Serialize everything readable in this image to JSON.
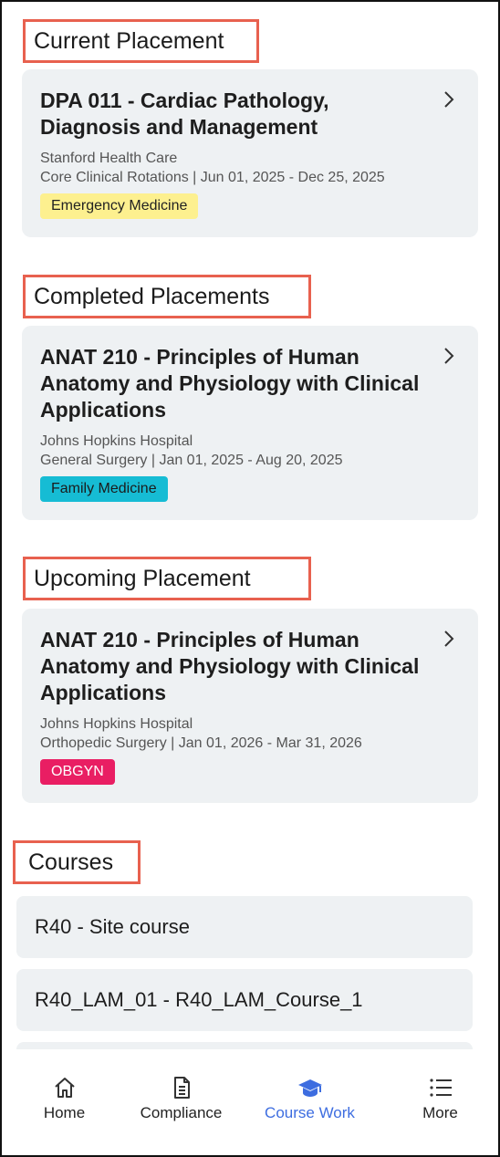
{
  "sections": {
    "current": "Current Placement",
    "completed": "Completed Placements",
    "upcoming": "Upcoming Placement",
    "courses": "Courses"
  },
  "current_card": {
    "title": "DPA 011 - Cardiac Pathology, Diagnosis and Management",
    "org": "Stanford Health Care",
    "meta": "Core Clinical Rotations | Jun 01, 2025 - Dec 25, 2025",
    "tag": "Emergency Medicine",
    "tag_color": "#fdf08f"
  },
  "completed_card": {
    "title": "ANAT 210 - Principles of Human Anatomy and Physiology with Clinical Applications",
    "org": "Johns Hopkins Hospital",
    "meta": "General Surgery | Jan 01, 2025 - Aug 20, 2025",
    "tag": "Family Medicine",
    "tag_color": "#16bcd4"
  },
  "upcoming_card": {
    "title": "ANAT 210 - Principles of Human Anatomy and Physiology with Clinical Applications",
    "org": "Johns Hopkins Hospital",
    "meta": "Orthopedic Surgery | Jan 01, 2026 - Mar 31, 2026",
    "tag": "OBGYN",
    "tag_color": "#e91e63"
  },
  "courses": [
    "R40 - Site course",
    "R40_LAM_01 - R40_LAM_Course_1"
  ],
  "nav": {
    "home": "Home",
    "compliance": "Compliance",
    "coursework": "Course Work",
    "more": "More",
    "active": "coursework",
    "active_color": "#3d6de0"
  }
}
